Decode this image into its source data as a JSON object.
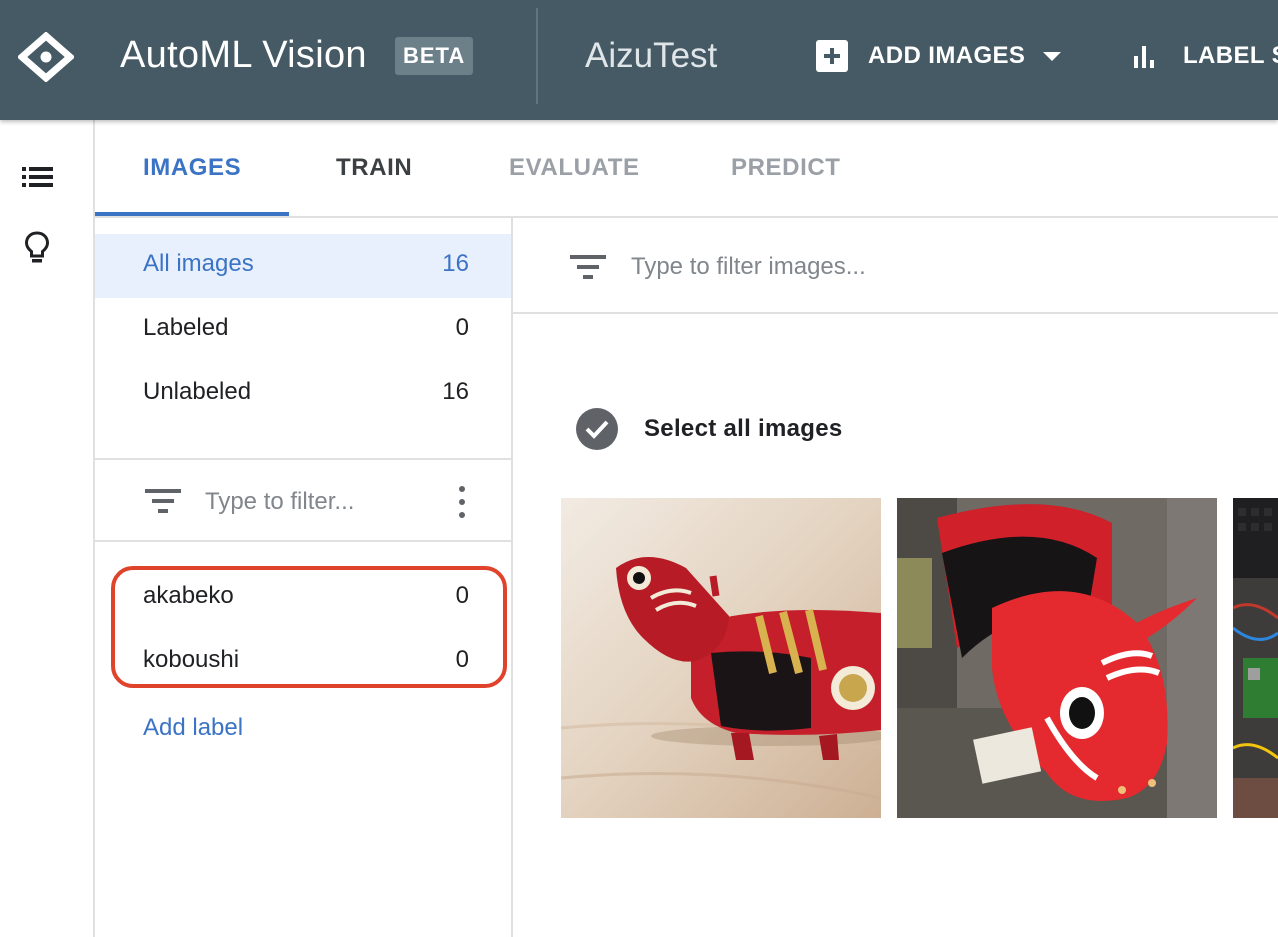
{
  "header": {
    "app_title": "AutoML Vision",
    "badge": "BETA",
    "project_name": "AizuTest",
    "add_images_label": "ADD IMAGES",
    "label_stats_label": "LABEL S"
  },
  "tabs": [
    {
      "label": "IMAGES",
      "state": "active"
    },
    {
      "label": "TRAIN",
      "state": "enabled"
    },
    {
      "label": "EVALUATE",
      "state": "disabled"
    },
    {
      "label": "PREDICT",
      "state": "disabled"
    }
  ],
  "categories": [
    {
      "name": "All images",
      "count": "16",
      "selected": true
    },
    {
      "name": "Labeled",
      "count": "0"
    },
    {
      "name": "Unlabeled",
      "count": "16"
    }
  ],
  "label_filter": {
    "placeholder": "Type to filter..."
  },
  "labels": [
    {
      "name": "akabeko",
      "count": "0"
    },
    {
      "name": "koboushi",
      "count": "0"
    }
  ],
  "add_label": "Add label",
  "image_filter": {
    "placeholder": "Type to filter images..."
  },
  "select_all": "Select all images",
  "images": [
    {
      "subject": "red papier-mache cow toy on wooden table"
    },
    {
      "subject": "large red cow head statue"
    },
    {
      "subject": "electronics and wires"
    }
  ],
  "colors": {
    "header_bg": "#455a64",
    "accent_blue": "#3b73c5",
    "highlight_red": "#e0432b",
    "selected_bg": "#e8f0fe"
  }
}
